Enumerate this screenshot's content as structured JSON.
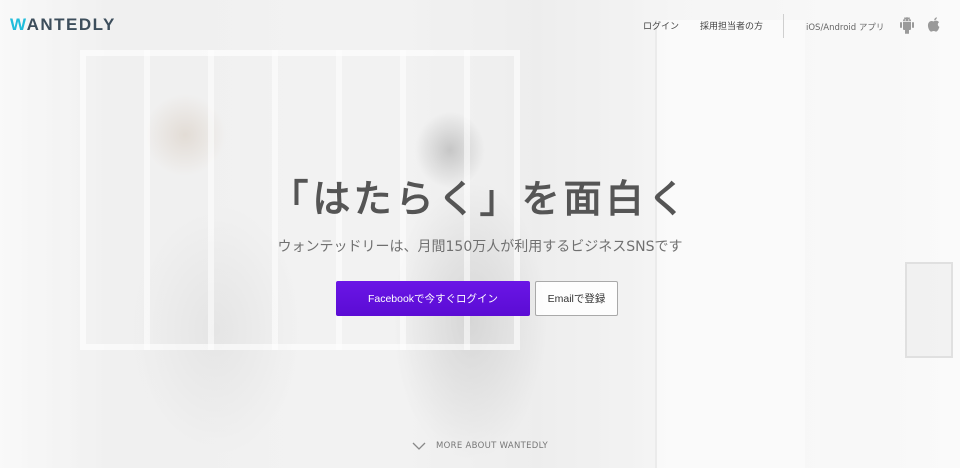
{
  "brand": {
    "logo_first": "W",
    "logo_rest": "ANTEDLY"
  },
  "nav": {
    "login": "ログイン",
    "recruiter": "採用担当者の方",
    "apps_label": "iOS/Android アプリ",
    "icons": [
      "android-icon",
      "apple-icon"
    ]
  },
  "hero": {
    "headline": "「はたらく」を面白く",
    "tagline": "ウォンテッドリーは、月間150万人が利用するビジネスSNSです",
    "facebook_button": "Facebookで今すぐログイン",
    "email_button": "Emailで登録",
    "more_link": "MORE ABOUT WANTEDLY"
  },
  "colors": {
    "accent": "#5c0fd9",
    "logo_accent": "#21bddb",
    "logo_text": "#3d4e5c"
  }
}
